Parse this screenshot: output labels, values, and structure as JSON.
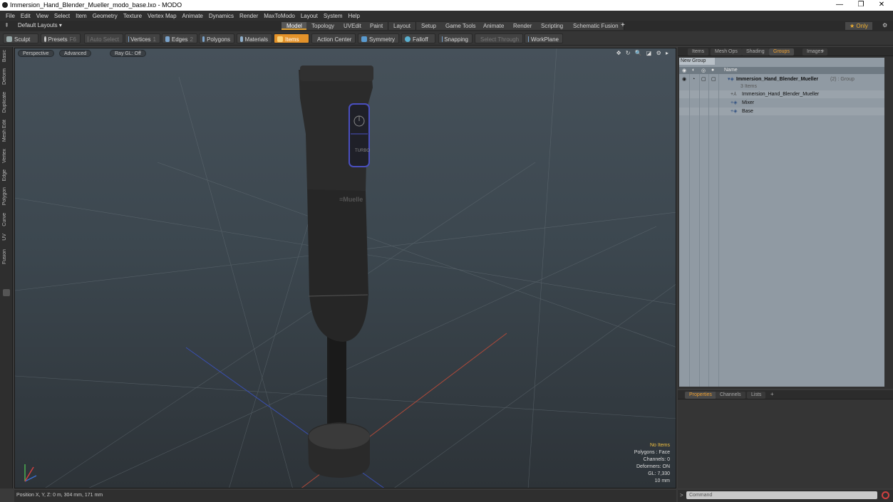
{
  "window": {
    "title": "Immersion_Hand_Blender_Mueller_modo_base.lxo - MODO",
    "minimize": "—",
    "restore": "❐",
    "close": "✕"
  },
  "menu": [
    "File",
    "Edit",
    "View",
    "Select",
    "Item",
    "Geometry",
    "Texture",
    "Vertex Map",
    "Animate",
    "Dynamics",
    "Render",
    "MaxToModo",
    "Layout",
    "System",
    "Help"
  ],
  "layouts": {
    "selector": "Default Layouts ▾",
    "tabs": [
      "Model",
      "Topology",
      "UVEdit",
      "Paint",
      "Layout",
      "Setup",
      "Game Tools",
      "Animate",
      "Render",
      "Scripting",
      "Schematic Fusion"
    ],
    "active": "Model",
    "add": "+",
    "only": "★ Only",
    "gear": "⚙"
  },
  "toolbar": {
    "sculpt": "Sculpt",
    "presets": "Presets",
    "presets_key": "F6",
    "auto_select": "Auto Select",
    "vertices": "Vertices",
    "vertices_key": "1",
    "edges": "Edges",
    "edges_key": "2",
    "polygons": "Polygons",
    "materials": "Materials",
    "items": "Items",
    "action_center": "Action Center",
    "symmetry": "Symmetry",
    "falloff": "Falloff",
    "snapping": "Snapping",
    "select_through": "Select Through",
    "workplane": "WorkPlane"
  },
  "left_tabs": [
    "Basic",
    "Deform",
    "Duplicate",
    "Mesh Edit",
    "Vertex",
    "Edge",
    "Polygon",
    "Curve",
    "UV",
    "Fusion"
  ],
  "viewport": {
    "tabs": [
      "Perspective",
      "Advanced",
      "Ray GL: Off"
    ],
    "icons": "✥ ↻ 🔍 ◪ ⚙ ▸",
    "device_labels": {
      "power": "⏻",
      "turbo": "TURBO",
      "brand": "≡Muelle"
    },
    "stats": {
      "selection": "No Items",
      "polygons": "Polygons : Face",
      "channels": "Channels: 0",
      "deformers": "Deformers: ON",
      "gl": "GL: 7,330",
      "scale": "10 mm"
    }
  },
  "status": {
    "position": "Position X, Y, Z:   0 m, 304 mm, 171 mm"
  },
  "right_panel": {
    "tabs": [
      "Items",
      "Mesh Ops",
      "Shading",
      "Groups",
      "Images"
    ],
    "active": "Groups",
    "add": "+",
    "new_group": "New Group",
    "col_name": "Name",
    "group_name": "Immersion_Hand_Blender_Mueller",
    "group_suffix": "(2) : Group",
    "group_count": "3 Items",
    "children": [
      "Immersion_Hand_Blender_Mueller",
      "Mixer",
      "Base"
    ]
  },
  "properties": {
    "tabs": [
      "Properties",
      "Channels",
      "Lists"
    ],
    "active": "Properties",
    "add": "+"
  },
  "command": {
    "placeholder": "Command",
    "prompt": ">"
  },
  "colors": {
    "accent": "#e3922a",
    "viewport": "#3c474f",
    "groups_bg": "#909aa3"
  }
}
